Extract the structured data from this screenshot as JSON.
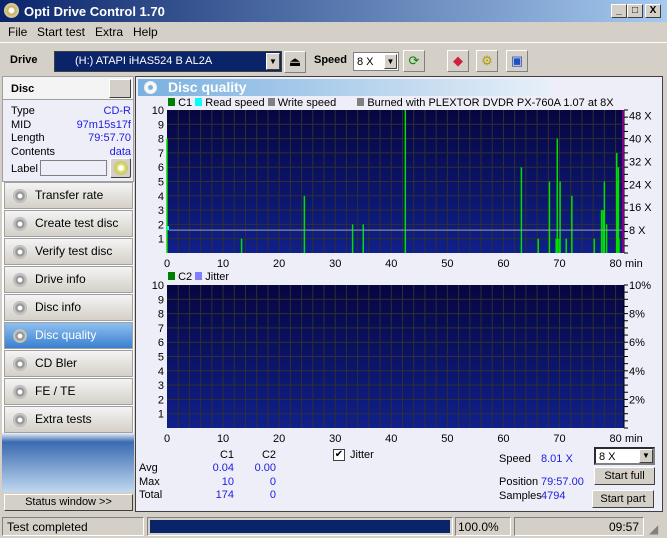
{
  "window": {
    "title": "Opti Drive Control 1.70",
    "buttons": [
      "_",
      "□",
      "X"
    ]
  },
  "menu": [
    "File",
    "Start test",
    "Extra",
    "Help"
  ],
  "toolbar": {
    "drive_label": "Drive",
    "drive_value": "(H:)   ATAPI iHAS524   B AL2A",
    "speed_label": "Speed",
    "speed_value": "8 X"
  },
  "disc": {
    "header": "Disc",
    "rows": [
      {
        "k": "Type",
        "v": "CD-R"
      },
      {
        "k": "MID",
        "v": "97m15s17f"
      },
      {
        "k": "Length",
        "v": "79:57.70"
      },
      {
        "k": "Contents",
        "v": "data"
      }
    ],
    "label_label": "Label",
    "label_value": ""
  },
  "nav": [
    {
      "label": "Transfer rate"
    },
    {
      "label": "Create test disc"
    },
    {
      "label": "Verify test disc"
    },
    {
      "label": "Drive info"
    },
    {
      "label": "Disc info"
    },
    {
      "label": "Disc quality",
      "active": true
    },
    {
      "label": "CD Bler"
    },
    {
      "label": "FE / TE"
    },
    {
      "label": "Extra tests"
    }
  ],
  "status_window_btn": "Status window >>",
  "panel_title": "Disc quality",
  "chart_data": [
    {
      "type": "bar",
      "legend": [
        "C1",
        "Read speed",
        "Write speed",
        "Burned with PLEXTOR DVDR   PX-760A 1.07 at 8X"
      ],
      "colors": {
        "C1": "#00e000",
        "Read speed": "#00ffff",
        "Write speed": "#808080",
        "background": "#0a1a6a"
      },
      "xlim": [
        0,
        81.5
      ],
      "xticks": [
        0,
        10,
        20,
        30,
        40,
        50,
        60,
        70,
        80
      ],
      "xunit": "min",
      "ylim": [
        0,
        10
      ],
      "yticks": [
        1,
        2,
        3,
        4,
        5,
        6,
        7,
        8,
        9,
        10
      ],
      "y2ticks": [
        "8 X",
        "16 X",
        "24 X",
        "32 X",
        "40 X",
        "48 X"
      ],
      "y2lim": [
        0,
        50
      ],
      "c1": [
        [
          0,
          8
        ],
        [
          13.3,
          1
        ],
        [
          24.5,
          4
        ],
        [
          33.1,
          2
        ],
        [
          35.0,
          2
        ],
        [
          42.5,
          10
        ],
        [
          63.2,
          6
        ],
        [
          66.2,
          1
        ],
        [
          68.2,
          5
        ],
        [
          69.4,
          1
        ],
        [
          69.6,
          8
        ],
        [
          69.9,
          1
        ],
        [
          70.1,
          5
        ],
        [
          71.2,
          1
        ],
        [
          72.2,
          4
        ],
        [
          76.2,
          1
        ],
        [
          77.5,
          3
        ],
        [
          77.8,
          3
        ],
        [
          78.0,
          5
        ],
        [
          78.4,
          2
        ],
        [
          80.2,
          7
        ],
        [
          80.3,
          5
        ],
        [
          80.5,
          6
        ],
        [
          80.6,
          1
        ]
      ],
      "read_speed_x": 8.0
    },
    {
      "type": "bar",
      "legend": [
        "C2",
        "Jitter"
      ],
      "colors": {
        "C2": "#00e000",
        "Jitter": "#8080ff"
      },
      "xlim": [
        0,
        81.5
      ],
      "xticks": [
        0,
        10,
        20,
        30,
        40,
        50,
        60,
        70,
        80
      ],
      "xunit": "min",
      "ylim": [
        0,
        10
      ],
      "yticks": [
        1,
        2,
        3,
        4,
        5,
        6,
        7,
        8,
        9,
        10
      ],
      "y2ticks": [
        "2%",
        "4%",
        "6%",
        "8%",
        "10%"
      ],
      "c2": []
    }
  ],
  "stats": {
    "headers": [
      "C1",
      "C2"
    ],
    "rows": [
      {
        "k": "Avg",
        "c1": "0.04",
        "c2": "0.00"
      },
      {
        "k": "Max",
        "c1": "10",
        "c2": "0"
      },
      {
        "k": "Total",
        "c1": "174",
        "c2": "0"
      }
    ],
    "jitter_label": "Jitter",
    "jitter_checked": true,
    "speed_label": "Speed",
    "speed_value": "8.01 X",
    "position_label": "Position",
    "position_value": "79:57.00",
    "samples_label": "Samples",
    "samples_value": "4794",
    "speed_select": "8 X",
    "start_full": "Start full",
    "start_part": "Start part"
  },
  "statusbar": {
    "text": "Test completed",
    "progress": 100.0,
    "progress_text": "100.0%",
    "time": "09:57"
  }
}
